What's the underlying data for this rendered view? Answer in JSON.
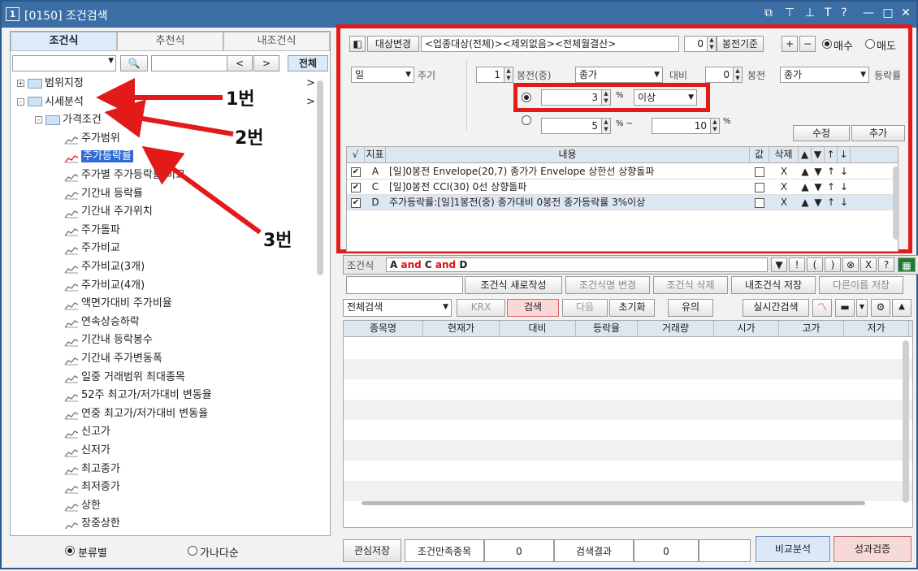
{
  "window": {
    "number": "1",
    "title": "[0150] 조건검색",
    "controls": [
      "⧉",
      "⊤",
      "⊥",
      "T",
      "?",
      "—",
      "□",
      "✕"
    ]
  },
  "left": {
    "tabs": [
      "조건식",
      "추천식",
      "내조건식"
    ],
    "nav": {
      "prev": "<",
      "next": ">",
      "all": "전체"
    },
    "tree": [
      {
        "label": "범위지정",
        "level": 0,
        "type": "folder",
        "exp": "+",
        "arrow": ">"
      },
      {
        "label": "시세분석",
        "level": 0,
        "type": "folder",
        "exp": "-",
        "arrow": ">"
      },
      {
        "label": "가격조건",
        "level": 1,
        "type": "folder",
        "exp": "-"
      },
      {
        "label": "주가범위",
        "level": 2,
        "type": "chart"
      },
      {
        "label": "주가등락률",
        "level": 2,
        "type": "chart",
        "selected": true
      },
      {
        "label": "주가별 주가등락률 비교",
        "level": 2,
        "type": "chart"
      },
      {
        "label": "기간내 등락률",
        "level": 2,
        "type": "chart"
      },
      {
        "label": "기간내 주가위치",
        "level": 2,
        "type": "chart"
      },
      {
        "label": "주가돌파",
        "level": 2,
        "type": "chart"
      },
      {
        "label": "주가비교",
        "level": 2,
        "type": "chart"
      },
      {
        "label": "주가비교(3개)",
        "level": 2,
        "type": "chart"
      },
      {
        "label": "주가비교(4개)",
        "level": 2,
        "type": "chart"
      },
      {
        "label": "액면가대비 주가비율",
        "level": 2,
        "type": "chart"
      },
      {
        "label": "연속상승하락",
        "level": 2,
        "type": "chart"
      },
      {
        "label": "기간내 등락봉수",
        "level": 2,
        "type": "chart"
      },
      {
        "label": "기간내 주가변동폭",
        "level": 2,
        "type": "chart"
      },
      {
        "label": "일중 거래범위 최대종목",
        "level": 2,
        "type": "chart"
      },
      {
        "label": "52주 최고가/저가대비 변동율",
        "level": 2,
        "type": "chart"
      },
      {
        "label": "연중 최고가/저가대비 변동율",
        "level": 2,
        "type": "chart"
      },
      {
        "label": "신고가",
        "level": 2,
        "type": "chart"
      },
      {
        "label": "신저가",
        "level": 2,
        "type": "chart"
      },
      {
        "label": "최고종가",
        "level": 2,
        "type": "chart"
      },
      {
        "label": "최저종가",
        "level": 2,
        "type": "chart"
      },
      {
        "label": "상한",
        "level": 2,
        "type": "chart"
      },
      {
        "label": "장중상한",
        "level": 2,
        "type": "chart"
      }
    ],
    "sort": {
      "opt1": "분류별",
      "opt2": "가나다순"
    },
    "annotations": [
      "1번",
      "2번",
      "3번"
    ]
  },
  "cond": {
    "target_btn": "대상변경",
    "target_text": "<업종대상(전체)><제외없음><전체월결산>",
    "bong_val": "0",
    "bong_label": "봉전기준",
    "plus": "+",
    "minus": "−",
    "buy": "매수",
    "sell": "매도",
    "period": "일",
    "period_label": "주기",
    "n1": "1",
    "bong_mid": "봉전(중)",
    "price1": "종가",
    "daebi": "대비",
    "n2": "0",
    "bong2": "봉전",
    "price2": "종가",
    "rate": "등락률",
    "pct1": "3",
    "pct_sym": "%",
    "cmp": "이상",
    "pct2": "5",
    "tilde": "% ~",
    "pct3": "10",
    "pct_sym2": "%",
    "edit": "수정",
    "add": "추가"
  },
  "ind": {
    "headers": [
      "√",
      "지표",
      "내용",
      "값",
      "삭제",
      "▲",
      "▼",
      "↑",
      "↓"
    ],
    "rows": [
      {
        "id": "A",
        "text": "[일]0봉전 Envelope(20,7) 종가가 Envelope 상한선 상향돌파",
        "del": "X"
      },
      {
        "id": "C",
        "text": "[일]0봉전 CCI(30) 0선 상향돌파",
        "del": "X"
      },
      {
        "id": "D",
        "text": "주가등락률:[일]1봉전(중) 종가대비 0봉전 종가등락률 3%이상",
        "del": "X"
      }
    ]
  },
  "formula": {
    "label": "조건식",
    "a": "A",
    "and1": "and",
    "c": "C",
    "and2": "and",
    "d": "D",
    "tools": [
      "▼",
      "!",
      "(",
      ")",
      "⊗",
      "X",
      "?"
    ]
  },
  "actions": [
    "조건식 새로작성",
    "조건식명 변경",
    "조건식 삭제",
    "내조건식 저장",
    "다른이름 저장"
  ],
  "search": {
    "scope": "전체검색",
    "krx": "KRX",
    "search": "검색",
    "next": "다음",
    "reset": "초기화",
    "caution": "유의",
    "realtime": "실시간검색"
  },
  "results": {
    "headers": [
      "종목명",
      "현재가",
      "대비",
      "등락율",
      "거래량",
      "시가",
      "고가",
      "저가"
    ]
  },
  "footer": {
    "save": "관심저장",
    "matched": "조건만족종목",
    "matched_val": "0",
    "result": "검색결과",
    "result_val": "0",
    "compare": "비교분석",
    "verify": "성과검증"
  }
}
